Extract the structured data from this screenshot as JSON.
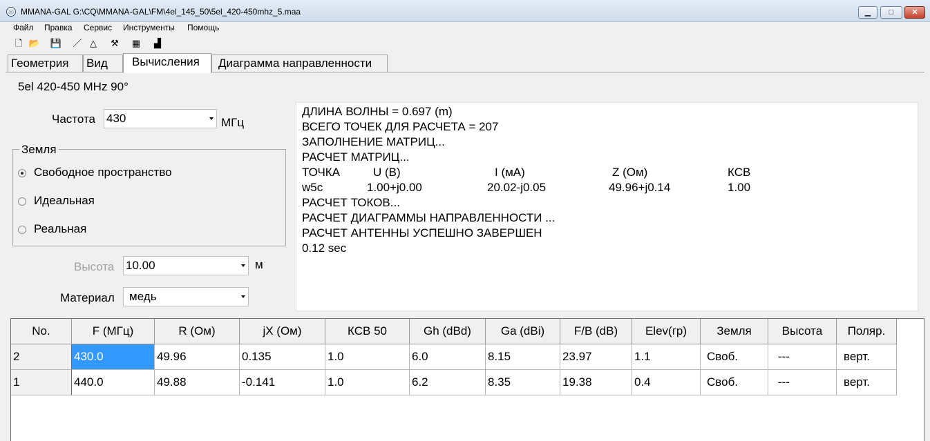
{
  "window": {
    "title": "MMANA-GAL G:\\CQ\\MMANA-GAL\\FM\\4el_145_50\\5el_420-450mhz_5.maa",
    "icon": "app-icon",
    "minimize_label": "▁",
    "maximize_label": "□",
    "close_label": "✕"
  },
  "menu": [
    "Файл",
    "Правка",
    "Сервис",
    "Инструменты",
    "Помощь"
  ],
  "toolbar": {
    "new_glyph": "🗋",
    "open_glyph": "📂",
    "save_glyph": "💾",
    "wire_glyph": "／",
    "triangle_glyph": "△",
    "tools_glyph": "⚒",
    "calc_glyph": "▦",
    "optim_glyph": "▟"
  },
  "tabs": [
    "Геометрия",
    "Вид",
    "Вычисления",
    "Диаграмма направленности"
  ],
  "active_tab": "Вычисления",
  "panel_title": "5el  420-450 MHz 90°",
  "frequency": {
    "label": "Частота",
    "value": "430",
    "unit": "МГц"
  },
  "ground": {
    "legend": "Земля",
    "options": [
      "Свободное пространство",
      "Идеальная",
      "Реальная"
    ],
    "selected": "Свободное пространство"
  },
  "height": {
    "label": "Высота",
    "value": "10.00",
    "unit": "м"
  },
  "material": {
    "label": "Материал",
    "value": "медь"
  },
  "output": {
    "lines": [
      "ДЛИНА ВОЛНЫ = 0.697 (m)",
      "ВСЕГО ТОЧЕК ДЛЯ РАСЧЕТА = 207",
      "ЗАПОЛНЕНИЕ МАТРИЦ...",
      "РАСЧЕТ МАТРИЦ..."
    ],
    "header": [
      "ТОЧКА",
      "U (В)",
      "I (мА)",
      "Z (Ом)",
      "КСВ"
    ],
    "row": [
      "w5c",
      "1.00+j0.00",
      "20.02-j0.05",
      "49.96+j0.14",
      "1.00"
    ],
    "lines_after": [
      "РАСЧЕТ ТОКОВ...",
      "РАСЧЕТ ДИАГРАММЫ НАПРАВЛЕННОСТИ ...",
      "РАСЧЕТ АНТЕННЫ УСПЕШНО ЗАВЕРШЕН",
      "0.12 sec"
    ]
  },
  "table": {
    "columns": [
      "No.",
      "F (МГц)",
      "R (Ом)",
      "jX (Ом)",
      "КСВ 50",
      "Gh (dBd)",
      "Ga (dBi)",
      "F/B (dB)",
      "Elev(гр)",
      "Земля",
      "Высота",
      "Поляр."
    ],
    "rows": [
      [
        "2",
        "430.0",
        "49.96",
        "0.135",
        "1.0",
        "6.0",
        "8.15",
        "23.97",
        "1.1",
        "Своб.",
        "---",
        "верт."
      ],
      [
        "1",
        "440.0",
        "49.88",
        "-0.141",
        "1.0",
        "6.2",
        "8.35",
        "19.38",
        "0.4",
        "Своб.",
        "---",
        "верт."
      ]
    ]
  }
}
